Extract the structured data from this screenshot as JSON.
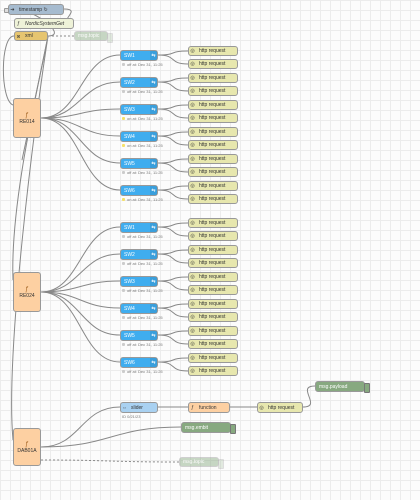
{
  "colors": {
    "switch": "#3fadef",
    "http": "#e7e7ae",
    "room": "#fdd0a2",
    "debug": "#87a980",
    "inject": "#a6bbcf",
    "func": "#fdd0a2",
    "wire": "#888888",
    "status_green": "#f6e16a",
    "status_grey": "#cccccc"
  },
  "top": {
    "timestamp": {
      "label": "timestamp ↻",
      "icon": "arrow-icon"
    },
    "nordic": {
      "label": "NordicSystemGet"
    },
    "xml": {
      "label": "xml"
    },
    "msg_topic_top": {
      "label": "msg.topic"
    }
  },
  "groups": [
    {
      "room": "RE014",
      "switches": [
        {
          "label": "SW1",
          "status": "off at: Dec 31, 11:25"
        },
        {
          "label": "SW2",
          "status": "off at: Dec 31, 11:25"
        },
        {
          "label": "SW3",
          "status": "on at: Dec 31, 11:25"
        },
        {
          "label": "SW4",
          "status": "on at: Dec 31, 11:25"
        },
        {
          "label": "SW5",
          "status": "off at: Dec 31, 11:25"
        },
        {
          "label": "SW6",
          "status": "on at: Dec 31, 11:25"
        }
      ]
    },
    {
      "room": "RE024",
      "switches": [
        {
          "label": "SW1",
          "status": "off at: Dec 31, 11:25"
        },
        {
          "label": "SW2",
          "status": "off at: Dec 31, 11:25"
        },
        {
          "label": "SW3",
          "status": "off at: Dec 31, 11:25"
        },
        {
          "label": "SW4",
          "status": "off at: Dec 31, 11:25"
        },
        {
          "label": "SW5",
          "status": "off at: Dec 31, 11:25"
        },
        {
          "label": "SW6",
          "status": "off at: Dec 31, 11:25"
        }
      ]
    }
  ],
  "http_label": "http request",
  "bottom": {
    "room": "DAB01A",
    "slider": {
      "label": "slider",
      "status": "ID 0/21/23"
    },
    "function": {
      "label": "function"
    },
    "http": {
      "label": "http request"
    },
    "msg_payload": {
      "label": "msg.payload"
    },
    "msg_embit": {
      "label": "msg.embit"
    },
    "msg_topic_bottom": {
      "label": "msg.topic"
    }
  }
}
